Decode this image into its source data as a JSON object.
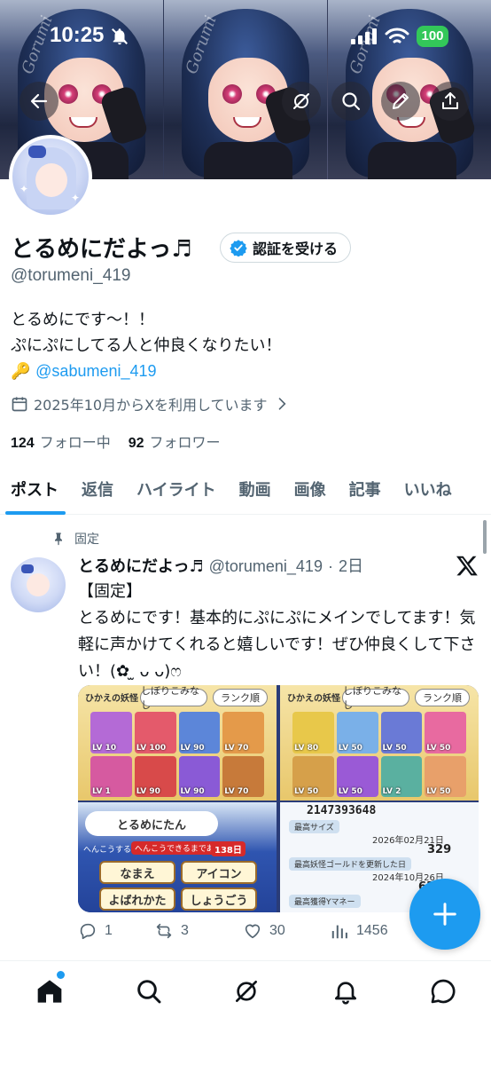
{
  "status_bar": {
    "time": "10:25",
    "battery": "100"
  },
  "profile": {
    "display_name": "とるめにだよっ♬",
    "verify_label": "認証を受ける",
    "handle": "@torumeni_419",
    "bio_line1": "とるめにです〜！！",
    "bio_line2": "ぷにぷにしてる人と仲良くなりたい！",
    "bio_key_emoji": "🔑",
    "bio_mention": "@sabumeni_419",
    "joined": "2025年10月からXを利用しています",
    "following_count": "124",
    "following_label": "フォロー中",
    "followers_count": "92",
    "followers_label": "フォロワー"
  },
  "tabs": [
    {
      "label": "ポスト",
      "active": true
    },
    {
      "label": "返信"
    },
    {
      "label": "ハイライト"
    },
    {
      "label": "動画"
    },
    {
      "label": "画像"
    },
    {
      "label": "記事"
    },
    {
      "label": "いいね"
    }
  ],
  "post": {
    "pinned_label": "固定",
    "author_name": "とるめにだよっ♬",
    "author_handle": "@torumeni_419",
    "dot": "·",
    "age": "2日",
    "text_line1": "【固定】",
    "text_body": "とるめにです！基本的にぷにぷにメインでしてます！気軽に声かけてくれると嬉しいです！ぜひ仲良くして下さい！(✿ ̫ ᴗ ᴗ)ෆ",
    "media": {
      "filter_label": "しぼりこみなし",
      "rank_label": "ランク順",
      "panel_title": "ひかえの妖怪",
      "name_plate": "とるめにたん",
      "change_label": "へんこうできるまであと",
      "change_cost": "138日",
      "btn_name": "なまえ",
      "btn_icon": "アイコン",
      "btn_call": "よばれかた",
      "btn_title": "しょうごう",
      "change_hint": "へんこうするもく",
      "stat_big": "2147393648",
      "stat_label1": "最高サイズ",
      "stat_date1": "2026年02月21日",
      "stat_value1": "329",
      "stat_label2": "最高妖怪ゴールドを更新した日",
      "stat_date2": "2024年10月26日",
      "stat_value2": "65000",
      "stat_label3": "最高獲得Yマネー",
      "lv_labels": [
        "LV 10",
        "LV 100",
        "LV 90",
        "LV 70",
        "LV 1",
        "LV 90",
        "LV 90",
        "LV 70",
        "LV 80",
        "LV 50",
        "LV 50",
        "LV 50",
        "LV 50",
        "LV 50",
        "LV 2",
        "LV 50"
      ]
    },
    "replies": "1",
    "reposts": "3",
    "likes": "30",
    "views": "1456"
  },
  "icons": {
    "back": "back-arrow-icon",
    "grok": "grok-icon",
    "search": "search-icon",
    "edit": "pencil-icon",
    "share": "share-icon",
    "calendar": "calendar-icon",
    "pin": "pin-icon",
    "x": "x-logo-icon",
    "compose": "plus-icon",
    "home": "home-icon",
    "explore": "search-icon",
    "grok_nav": "grok-icon",
    "notifications": "bell-icon",
    "messages": "chat-bubble-icon"
  },
  "colors": {
    "accent": "#1d9bf0",
    "text": "#0f1419",
    "muted": "#536471",
    "battery": "#33c759"
  }
}
